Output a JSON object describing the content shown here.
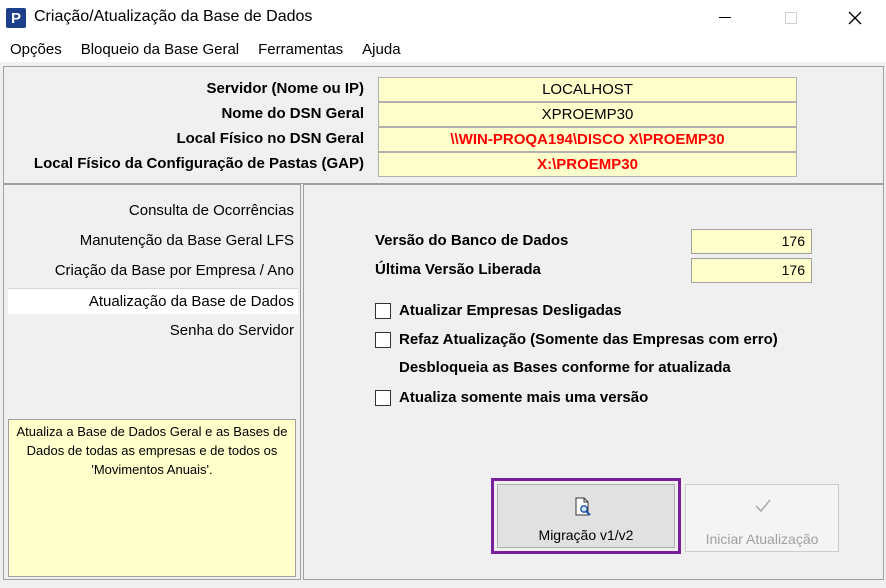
{
  "window": {
    "title": "Criação/Atualização da Base de Dados",
    "app_icon_letter": "P"
  },
  "menu": {
    "items": [
      "Opções",
      "Bloqueio da Base Geral",
      "Ferramentas",
      "Ajuda"
    ]
  },
  "server_info": {
    "rows": [
      {
        "label": "Servidor (Nome ou IP)",
        "value": "LOCALHOST",
        "highlight": false
      },
      {
        "label": "Nome do DSN Geral",
        "value": "XPROEMP30",
        "highlight": false
      },
      {
        "label": "Local Físico no DSN Geral",
        "value": "\\\\WIN-PROQA194\\DISCO X\\PROEMP30",
        "highlight": true
      },
      {
        "label": "Local Físico da Configuração de Pastas (GAP)",
        "value": "X:\\PROEMP30",
        "highlight": true
      }
    ]
  },
  "nav": {
    "items": [
      {
        "label": "Consulta de Ocorrências",
        "selected": false
      },
      {
        "label": "Manutenção da Base Geral LFS",
        "selected": false
      },
      {
        "label": "Criação da Base por Empresa / Ano",
        "selected": false
      },
      {
        "label": "Atualização da Base de Dados",
        "selected": true
      },
      {
        "label": "Senha do Servidor",
        "selected": false
      }
    ],
    "description": "Atualiza a Base de Dados Geral e as Bases de Dados de todas as empresas e de todos os 'Movimentos Anuais'."
  },
  "versions": {
    "db_label": "Versão do Banco de Dados",
    "db_value": "176",
    "released_label": "Última Versão Liberada",
    "released_value": "176"
  },
  "options": {
    "opt1": "Atualizar Empresas Desligadas",
    "opt2": "Refaz Atualização (Somente das Empresas com erro)",
    "opt2_note": "Desbloqueia as Bases conforme for atualizada",
    "opt3": "Atualiza somente mais uma versão",
    "opt1_checked": false,
    "opt2_checked": false,
    "opt3_checked": false
  },
  "buttons": {
    "migracao": "Migração v1/v2",
    "iniciar": "Iniciar Atualização",
    "migracao_icon": "document-search-icon",
    "iniciar_icon": "checkmark-icon"
  },
  "colors": {
    "field_bg": "#ffffcc",
    "path_text": "#ff0000",
    "highlight_border": "#7a1f9c"
  }
}
